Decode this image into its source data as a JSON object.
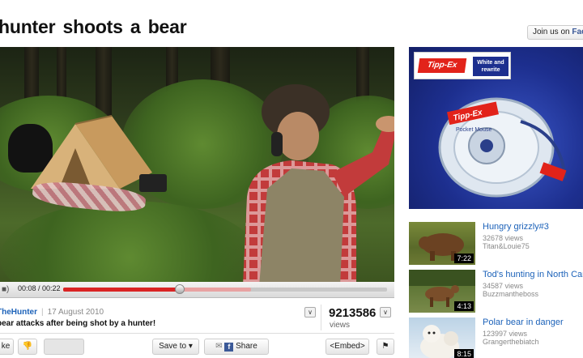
{
  "video": {
    "title": "hunter  shoots  a bear",
    "time": "00:08 / 00:22",
    "progress_played": 0.36,
    "progress_buffered": 0.58
  },
  "header": {
    "facebook_prefix": "Join us on",
    "facebook_brand": "Faceb"
  },
  "info": {
    "uploader": "TheHunter",
    "date": "17 August 2010",
    "description": "bear attacks after being shot by a hunter!",
    "views_count": "9213586",
    "views_label": "views"
  },
  "actions": {
    "like": "ke",
    "save_to": "Save to",
    "share": "Share",
    "embed": "<Embed>"
  },
  "ad": {
    "brand": "Tipp-Ex",
    "tagline": "White and rewrite",
    "product_brand": "Tipp-Ex",
    "product_name": "Pocket Mouse"
  },
  "related": [
    {
      "title": "Hungry grizzly#3",
      "views": "32678 views",
      "author": "Titan&Louie75",
      "duration": "7:22"
    },
    {
      "title": "Tod's hunting in North Caro",
      "views": "34587 views",
      "author": "Buzzmantheboss",
      "duration": "4:13"
    },
    {
      "title": "Polar bear in danger",
      "views": "123997 views",
      "author": "Grangerthebiatch",
      "duration": "8:15"
    }
  ],
  "colors": {
    "accent_red": "#d92424",
    "link_blue": "#1c62b9",
    "ad_blue": "#1d2f8f"
  },
  "icons": [
    "volume-icon",
    "chevron-down-icon",
    "dislike-icon",
    "email-icon",
    "facebook-icon",
    "flag-icon"
  ]
}
